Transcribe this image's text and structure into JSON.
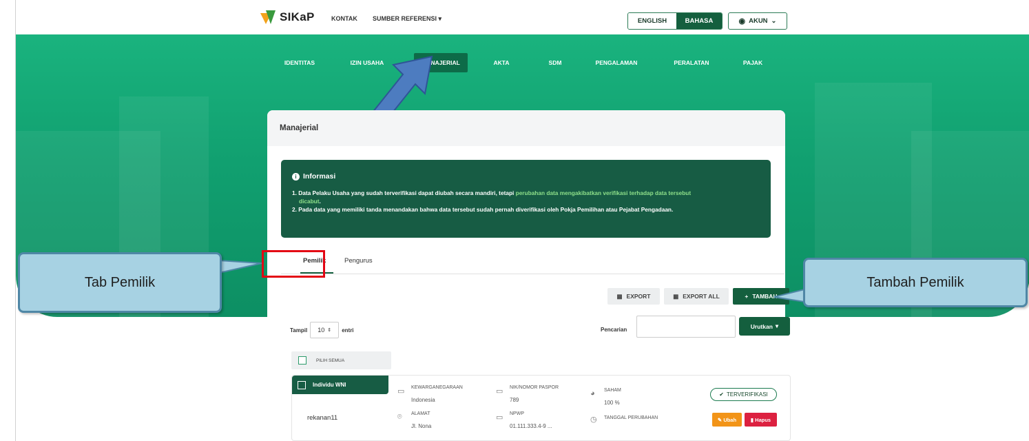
{
  "header": {
    "logo_text": "SIKaP",
    "nav": [
      "KONTAK",
      "SUMBER REFERENSI"
    ],
    "lang_en": "ENGLISH",
    "lang_id": "BAHASA",
    "account": "AKUN"
  },
  "menu": {
    "items": [
      "IDENTITAS",
      "IZIN USAHA",
      "MANAJERIAL",
      "AKTA",
      "SDM",
      "PENGALAMAN",
      "PERALATAN",
      "PAJAK"
    ],
    "active": "MANAJERIAL"
  },
  "card": {
    "title": "Manajerial",
    "info": {
      "title": "Informasi",
      "line1_a": "1. Data Pelaku Usaha yang sudah terverifikasi dapat diubah secara mandiri, tetapi ",
      "line1_hl": "perubahan data mengakibatkan verifikasi terhadap data tersebut",
      "line1_b": "dicabut",
      "line2": "2. Pada data yang memiliki tanda menandakan bahwa data tersebut sudah pernah diverifikasi oleh Pokja Pemilihan atau Pejabat Pengadaan."
    },
    "tabs": [
      "Pemilik",
      "Pengurus"
    ],
    "buttons": {
      "export": "EXPORT",
      "export_all": "EXPORT ALL",
      "tambah": "TAMBAH"
    },
    "tampil": {
      "label": "Tampil",
      "value": "10",
      "suffix": "entri"
    },
    "search_label": "Pencarian",
    "search_value": "",
    "sort_label": "Urutkan",
    "select_all": "PILIH SEMUA"
  },
  "row": {
    "type": "Individu WNI",
    "name": "rekanan11",
    "kewarganegaraan": {
      "label": "KEWARGANEGARAAN",
      "value": "Indonesia"
    },
    "nik": {
      "label": "NIK/NOMOR PASPOR",
      "value": "789"
    },
    "saham": {
      "label": "SAHAM",
      "value": "100 %"
    },
    "alamat": {
      "label": "ALAMAT",
      "value": "Jl. Nona"
    },
    "npwp": {
      "label": "NPWP",
      "value": "01.111.333.4-9 ..."
    },
    "tanggal": {
      "label": "TANGGAL PERUBAHAN",
      "value": ""
    },
    "status": "TERVERIFIKASI",
    "edit": "Ubah",
    "delete": "Hapus"
  },
  "callouts": {
    "tab_pemilik": "Tab Pemilik",
    "tambah_pemilik": "Tambah Pemilik"
  },
  "colors": {
    "primary": "#145f3e",
    "hero": "#11a070",
    "orange": "#f29418",
    "red": "#dc2140"
  }
}
